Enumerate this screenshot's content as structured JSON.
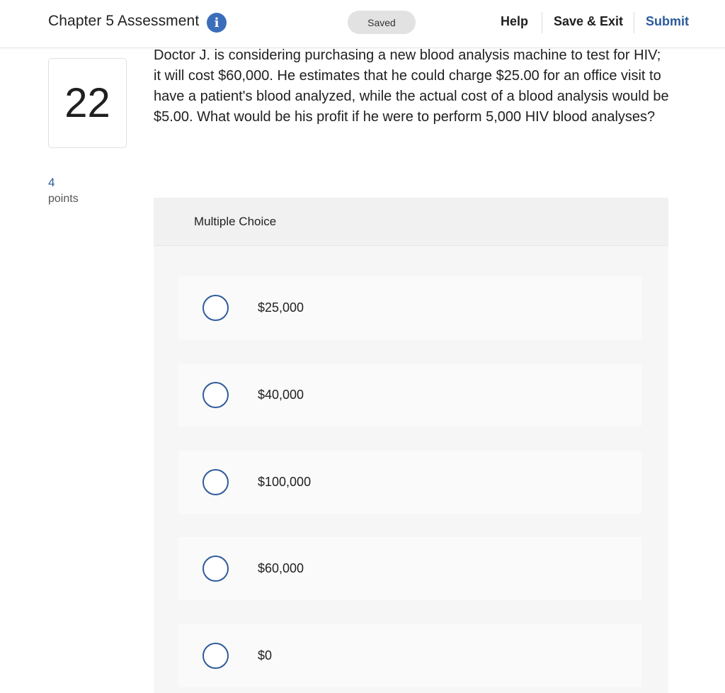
{
  "header": {
    "title": "Chapter 5 Assessment",
    "info_icon": "info-icon",
    "saved_label": "Saved",
    "help_label": "Help",
    "save_exit_label": "Save & Exit",
    "submit_label": "Submit"
  },
  "question": {
    "number": "22",
    "points_value": "4",
    "points_label": "points",
    "text": "Doctor J. is considering purchasing a new blood analysis machine to test for HIV; it will cost $60,000. He estimates that he could charge $25.00 for an office visit to have a patient's blood analyzed, while the actual cost of a blood analysis would be $5.00. What would be his profit if he were to perform 5,000 HIV blood analyses?"
  },
  "multiple_choice": {
    "label": "Multiple Choice",
    "options": [
      {
        "label": "$25,000"
      },
      {
        "label": "$40,000"
      },
      {
        "label": "$100,000"
      },
      {
        "label": "$60,000"
      },
      {
        "label": "$0"
      }
    ]
  },
  "colors": {
    "accent": "#2b5a9c",
    "info_icon": "#3b6dbb",
    "radio_border": "#2f5b99",
    "panel_bg": "#f1f1f1",
    "option_bg": "#fafafa"
  }
}
